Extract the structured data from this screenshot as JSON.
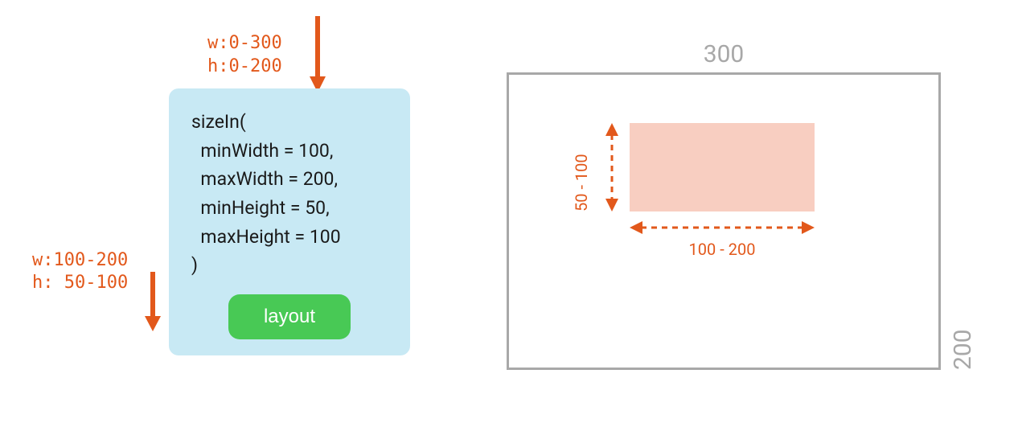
{
  "incoming": {
    "line1": "w:0-300",
    "line2": "h:0-200"
  },
  "outgoing": {
    "line1": "w:100-200",
    "line2": "h: 50-100"
  },
  "code": {
    "fn": "sizeIn(",
    "p1": "  minWidth = 100,",
    "p2": "  maxWidth = 200,",
    "p3": "  minHeight = 50,",
    "p4": "  maxHeight = 100",
    "close": ")"
  },
  "button": {
    "label": "layout"
  },
  "bounds": {
    "width": "300",
    "height": "200"
  },
  "dims": {
    "height_range": "50 - 100",
    "width_range": "100 - 200"
  }
}
